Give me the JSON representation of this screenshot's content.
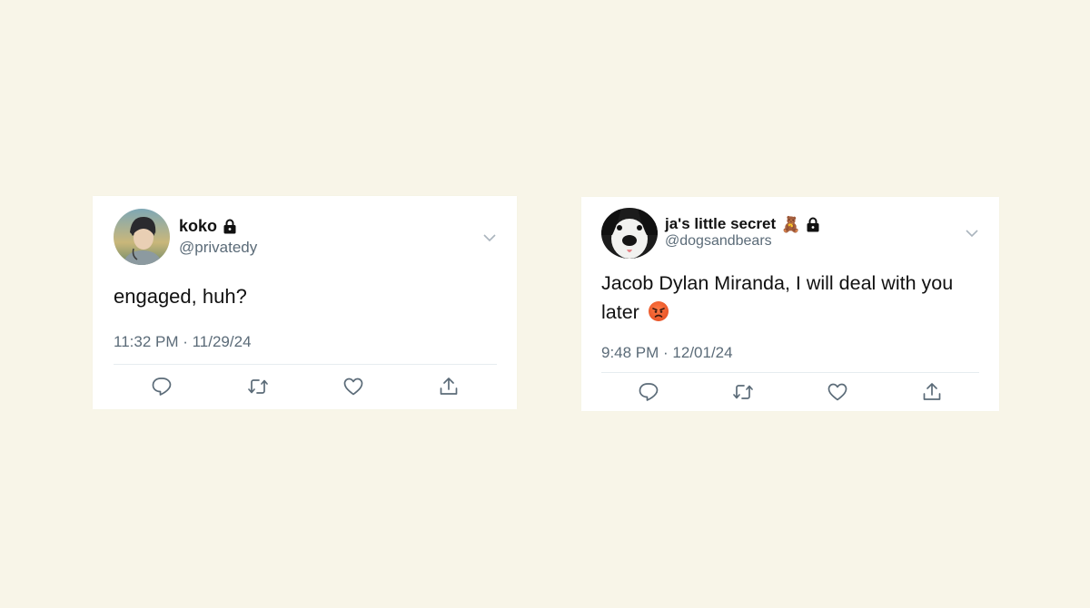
{
  "tweets": [
    {
      "display_name": "koko",
      "handle": "@privatedy",
      "text": "engaged, huh?",
      "timestamp": "11:32 PM · 11/29/24",
      "locked": true
    },
    {
      "display_name": "ja's little secret",
      "display_emoji": "🧸",
      "handle": "@dogsandbears",
      "text": "Jacob Dylan Miranda, I will deal with you later",
      "text_emoji": "😡",
      "timestamp": "9:48 PM · 12/01/24",
      "locked": true
    }
  ],
  "colors": {
    "background": "#f8f5e8",
    "card": "#ffffff",
    "secondary_text": "#5b6b78",
    "icon": "#5b6b78"
  },
  "icons": [
    "lock-icon",
    "chevron-down-icon",
    "reply-icon",
    "retweet-icon",
    "like-icon",
    "share-icon",
    "teddy-bear-icon",
    "angry-face-icon"
  ]
}
